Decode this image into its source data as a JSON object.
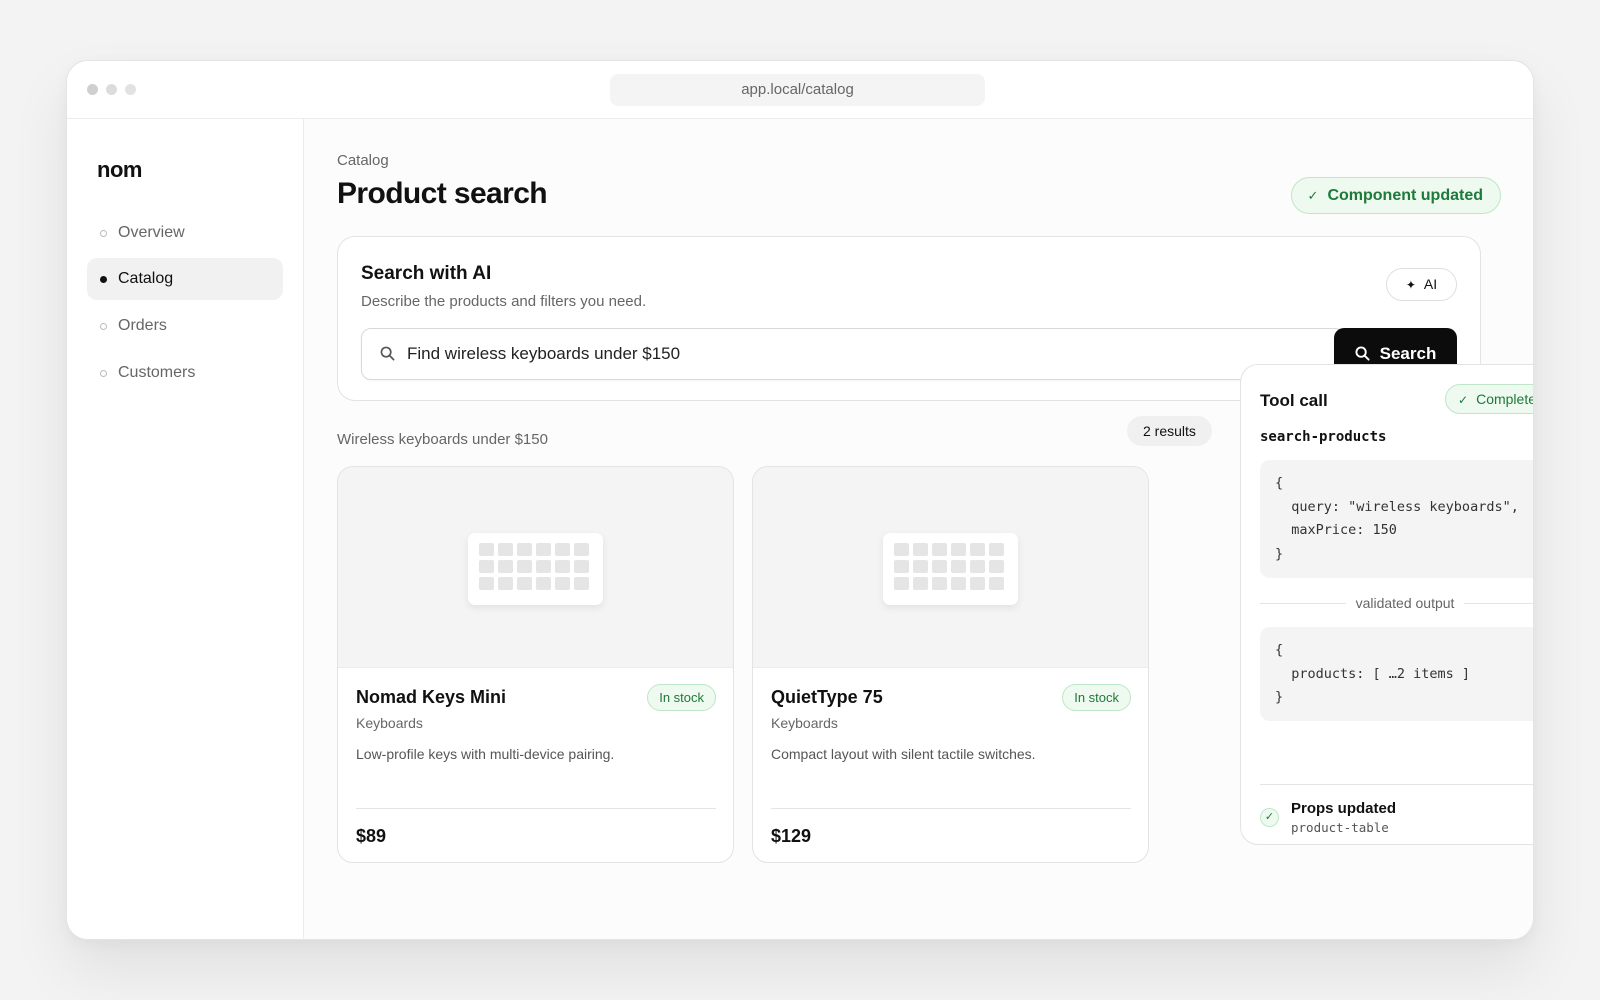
{
  "browser": {
    "url": "app.local/catalog"
  },
  "sidebar": {
    "logo": "nom",
    "items": [
      {
        "label": "Overview",
        "active": false
      },
      {
        "label": "Catalog",
        "active": true
      },
      {
        "label": "Orders",
        "active": false
      },
      {
        "label": "Customers",
        "active": false
      }
    ]
  },
  "header": {
    "breadcrumb": "Catalog",
    "title": "Product search",
    "status_badge": "Component updated"
  },
  "search": {
    "heading": "Search with AI",
    "subheading": "Describe the products and filters you need.",
    "ai_chip": "AI",
    "query": "Find wireless keyboards under $150",
    "button_label": "Search"
  },
  "results": {
    "label": "Wireless keyboards under $150",
    "count": "2 results",
    "products": [
      {
        "name": "Nomad Keys Mini",
        "category": "Keyboards",
        "stock": "In stock",
        "description": "Low-profile keys with multi-device pairing.",
        "price": "$89"
      },
      {
        "name": "QuietType 75",
        "category": "Keyboards",
        "stock": "In stock",
        "description": "Compact layout with silent tactile switches.",
        "price": "$129"
      }
    ]
  },
  "tool_call": {
    "title": "Tool call",
    "status": "Complete",
    "name": "search-products",
    "input_code": "{\n  query: \"wireless keyboards\",\n  maxPrice: 150\n}",
    "divider_label": "validated output",
    "output_code": "{\n  products: [ …2 items ]\n}",
    "props_title": "Props updated",
    "props_target": "product-table"
  },
  "colors": {
    "accent": "#0c0c0c",
    "success_text": "#1e7a3a",
    "success_bg": "#eef9f0",
    "success_border": "#bfe6c8"
  },
  "icons": [
    "search-icon",
    "check-icon",
    "sparkle-icon",
    "keyboard-icon"
  ]
}
